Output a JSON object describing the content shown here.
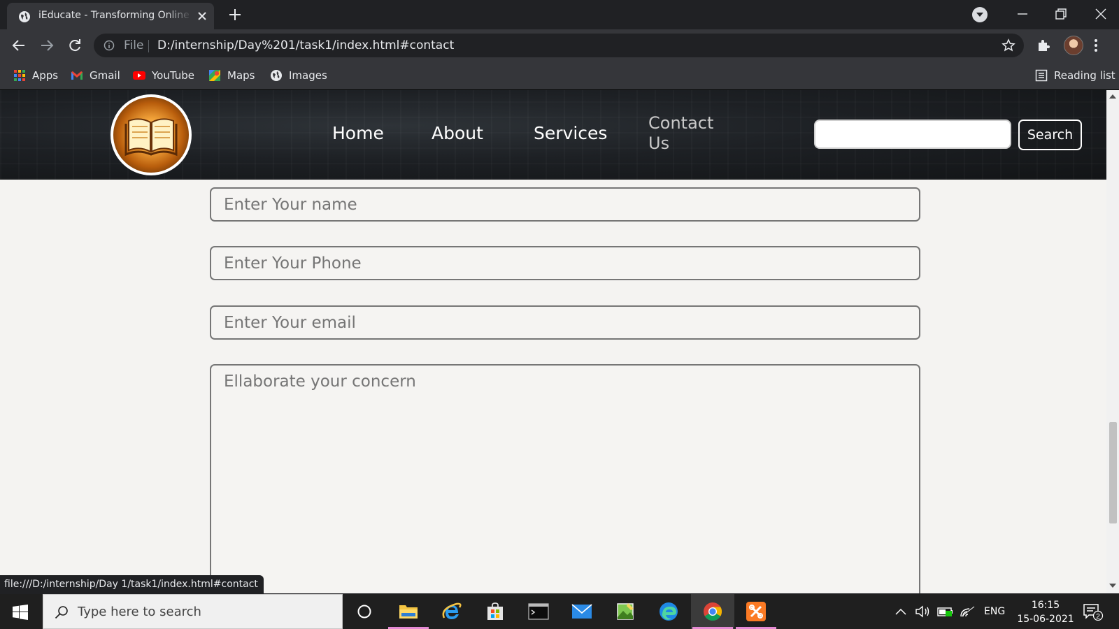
{
  "browser": {
    "tab_title": "iEducate - Transforming Online Education",
    "omnibox_scheme_label": "File",
    "url": "D:/internship/Day%201/task1/index.html#contact",
    "status_url": "file:///D:/internship/Day 1/task1/index.html#contact"
  },
  "bookmarks": [
    {
      "label": "Apps",
      "icon": "apps-grid-icon"
    },
    {
      "label": "Gmail",
      "icon": "gmail-icon"
    },
    {
      "label": "YouTube",
      "icon": "youtube-icon"
    },
    {
      "label": "Maps",
      "icon": "maps-icon"
    },
    {
      "label": "Images",
      "icon": "globe-icon"
    }
  ],
  "reading_list_label": "Reading list",
  "site": {
    "nav": [
      "Home",
      "About",
      "Services",
      "Contact Us"
    ],
    "search_button": "Search",
    "search_value": ""
  },
  "form": {
    "name_placeholder": "Enter Your name",
    "phone_placeholder": "Enter Your Phone",
    "email_placeholder": "Enter Your email",
    "concern_placeholder": "Ellaborate your concern"
  },
  "taskbar": {
    "search_placeholder": "Type here to search",
    "language": "ENG",
    "time": "16:15",
    "date": "15-06-2021",
    "notification_count": "2"
  },
  "colors": {
    "chrome_dark": "#202124",
    "chrome_toolbar": "#35363a",
    "page_background": "#f4f3f1",
    "field_border": "#767676"
  }
}
